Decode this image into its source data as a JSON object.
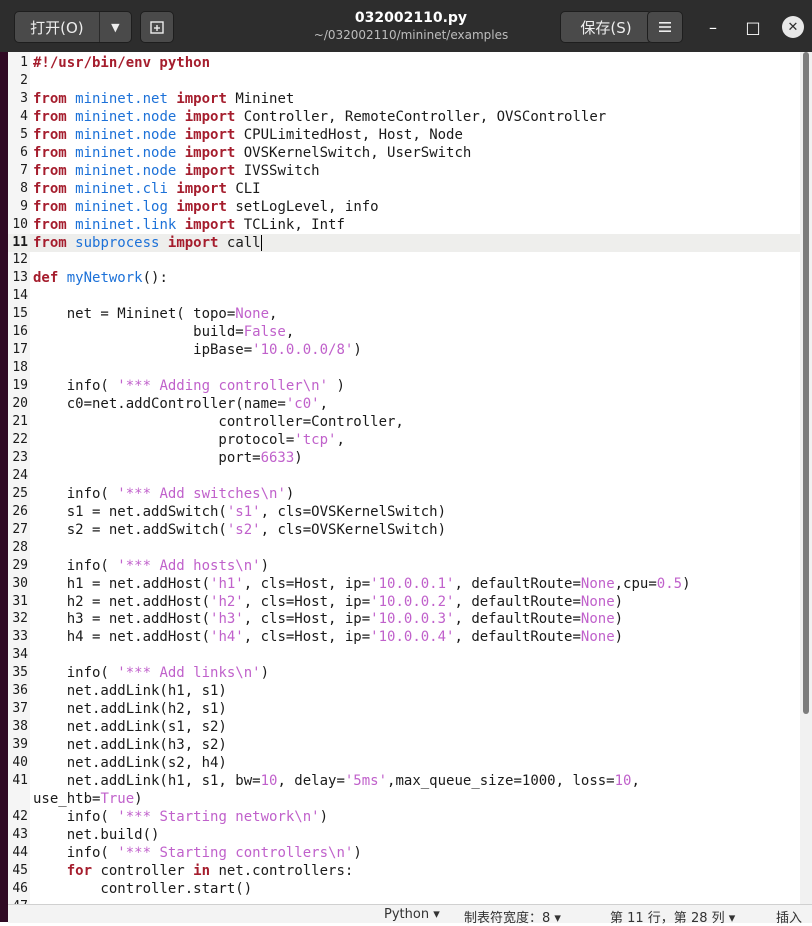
{
  "toolbar": {
    "open_label": "打开(O)",
    "open_menu_icon": "caret-down-icon",
    "new_tab_icon": "new-tab-icon",
    "save_label": "保存(S)",
    "menu_icon": "hamburger-icon"
  },
  "window": {
    "title": "032002110.py",
    "subtitle": "~/032002110/mininet/examples",
    "minimize": "–",
    "maximize": "□",
    "close": "✕"
  },
  "editor": {
    "current_line": 11,
    "lines": [
      {
        "n": "1",
        "tokens": [
          [
            "k",
            "#!/usr/bin/env python"
          ]
        ]
      },
      {
        "n": "2",
        "tokens": []
      },
      {
        "n": "3",
        "tokens": [
          [
            "k",
            "from"
          ],
          [
            "p",
            " "
          ],
          [
            "m",
            "mininet.net"
          ],
          [
            "p",
            " "
          ],
          [
            "k",
            "import"
          ],
          [
            "p",
            " Mininet"
          ]
        ]
      },
      {
        "n": "4",
        "tokens": [
          [
            "k",
            "from"
          ],
          [
            "p",
            " "
          ],
          [
            "m",
            "mininet.node"
          ],
          [
            "p",
            " "
          ],
          [
            "k",
            "import"
          ],
          [
            "p",
            " Controller, RemoteController, OVSController"
          ]
        ]
      },
      {
        "n": "5",
        "tokens": [
          [
            "k",
            "from"
          ],
          [
            "p",
            " "
          ],
          [
            "m",
            "mininet.node"
          ],
          [
            "p",
            " "
          ],
          [
            "k",
            "import"
          ],
          [
            "p",
            " CPULimitedHost, Host, Node"
          ]
        ]
      },
      {
        "n": "6",
        "tokens": [
          [
            "k",
            "from"
          ],
          [
            "p",
            " "
          ],
          [
            "m",
            "mininet.node"
          ],
          [
            "p",
            " "
          ],
          [
            "k",
            "import"
          ],
          [
            "p",
            " OVSKernelSwitch, UserSwitch"
          ]
        ]
      },
      {
        "n": "7",
        "tokens": [
          [
            "k",
            "from"
          ],
          [
            "p",
            " "
          ],
          [
            "m",
            "mininet.node"
          ],
          [
            "p",
            " "
          ],
          [
            "k",
            "import"
          ],
          [
            "p",
            " IVSSwitch"
          ]
        ]
      },
      {
        "n": "8",
        "tokens": [
          [
            "k",
            "from"
          ],
          [
            "p",
            " "
          ],
          [
            "m",
            "mininet.cli"
          ],
          [
            "p",
            " "
          ],
          [
            "k",
            "import"
          ],
          [
            "p",
            " CLI"
          ]
        ]
      },
      {
        "n": "9",
        "tokens": [
          [
            "k",
            "from"
          ],
          [
            "p",
            " "
          ],
          [
            "m",
            "mininet.log"
          ],
          [
            "p",
            " "
          ],
          [
            "k",
            "import"
          ],
          [
            "p",
            " setLogLevel, info"
          ]
        ]
      },
      {
        "n": "10",
        "tokens": [
          [
            "k",
            "from"
          ],
          [
            "p",
            " "
          ],
          [
            "m",
            "mininet.link"
          ],
          [
            "p",
            " "
          ],
          [
            "k",
            "import"
          ],
          [
            "p",
            " TCLink, Intf"
          ]
        ]
      },
      {
        "n": "11",
        "tokens": [
          [
            "k",
            "from"
          ],
          [
            "p",
            " "
          ],
          [
            "m",
            "subprocess"
          ],
          [
            "p",
            " "
          ],
          [
            "k",
            "import"
          ],
          [
            "p",
            " call"
          ]
        ]
      },
      {
        "n": "12",
        "tokens": []
      },
      {
        "n": "13",
        "tokens": [
          [
            "k",
            "def"
          ],
          [
            "p",
            " "
          ],
          [
            "m",
            "myNetwork"
          ],
          [
            "p",
            "():"
          ]
        ]
      },
      {
        "n": "14",
        "tokens": []
      },
      {
        "n": "15",
        "tokens": [
          [
            "p",
            "    net = Mininet( topo="
          ],
          [
            "s",
            "None"
          ],
          [
            "p",
            ","
          ]
        ]
      },
      {
        "n": "16",
        "tokens": [
          [
            "p",
            "                   build="
          ],
          [
            "s",
            "False"
          ],
          [
            "p",
            ","
          ]
        ]
      },
      {
        "n": "17",
        "tokens": [
          [
            "p",
            "                   ipBase="
          ],
          [
            "s",
            "'10.0.0.0/8'"
          ],
          [
            "p",
            ")"
          ]
        ]
      },
      {
        "n": "18",
        "tokens": []
      },
      {
        "n": "19",
        "tokens": [
          [
            "p",
            "    info( "
          ],
          [
            "s",
            "'*** Adding controller\\n'"
          ],
          [
            "p",
            " )"
          ]
        ]
      },
      {
        "n": "20",
        "tokens": [
          [
            "p",
            "    c0=net.addController(name="
          ],
          [
            "s",
            "'c0'"
          ],
          [
            "p",
            ","
          ]
        ]
      },
      {
        "n": "21",
        "tokens": [
          [
            "p",
            "                      controller=Controller,"
          ]
        ]
      },
      {
        "n": "22",
        "tokens": [
          [
            "p",
            "                      protocol="
          ],
          [
            "s",
            "'tcp'"
          ],
          [
            "p",
            ","
          ]
        ]
      },
      {
        "n": "23",
        "tokens": [
          [
            "p",
            "                      port="
          ],
          [
            "s",
            "6633"
          ],
          [
            "p",
            ")"
          ]
        ]
      },
      {
        "n": "24",
        "tokens": []
      },
      {
        "n": "25",
        "tokens": [
          [
            "p",
            "    info( "
          ],
          [
            "s",
            "'*** Add switches\\n'"
          ],
          [
            "p",
            ")"
          ]
        ]
      },
      {
        "n": "26",
        "tokens": [
          [
            "p",
            "    s1 = net.addSwitch("
          ],
          [
            "s",
            "'s1'"
          ],
          [
            "p",
            ", cls=OVSKernelSwitch)"
          ]
        ]
      },
      {
        "n": "27",
        "tokens": [
          [
            "p",
            "    s2 = net.addSwitch("
          ],
          [
            "s",
            "'s2'"
          ],
          [
            "p",
            ", cls=OVSKernelSwitch)"
          ]
        ]
      },
      {
        "n": "28",
        "tokens": []
      },
      {
        "n": "29",
        "tokens": [
          [
            "p",
            "    info( "
          ],
          [
            "s",
            "'*** Add hosts\\n'"
          ],
          [
            "p",
            ")"
          ]
        ]
      },
      {
        "n": "30",
        "tokens": [
          [
            "p",
            "    h1 = net.addHost("
          ],
          [
            "s",
            "'h1'"
          ],
          [
            "p",
            ", cls=Host, ip="
          ],
          [
            "s",
            "'10.0.0.1'"
          ],
          [
            "p",
            ", defaultRoute="
          ],
          [
            "s",
            "None"
          ],
          [
            "p",
            ",cpu="
          ],
          [
            "s",
            "0.5"
          ],
          [
            "p",
            ")"
          ]
        ]
      },
      {
        "n": "31",
        "tokens": [
          [
            "p",
            "    h2 = net.addHost("
          ],
          [
            "s",
            "'h2'"
          ],
          [
            "p",
            ", cls=Host, ip="
          ],
          [
            "s",
            "'10.0.0.2'"
          ],
          [
            "p",
            ", defaultRoute="
          ],
          [
            "s",
            "None"
          ],
          [
            "p",
            ")"
          ]
        ]
      },
      {
        "n": "32",
        "tokens": [
          [
            "p",
            "    h3 = net.addHost("
          ],
          [
            "s",
            "'h3'"
          ],
          [
            "p",
            ", cls=Host, ip="
          ],
          [
            "s",
            "'10.0.0.3'"
          ],
          [
            "p",
            ", defaultRoute="
          ],
          [
            "s",
            "None"
          ],
          [
            "p",
            ")"
          ]
        ]
      },
      {
        "n": "33",
        "tokens": [
          [
            "p",
            "    h4 = net.addHost("
          ],
          [
            "s",
            "'h4'"
          ],
          [
            "p",
            ", cls=Host, ip="
          ],
          [
            "s",
            "'10.0.0.4'"
          ],
          [
            "p",
            ", defaultRoute="
          ],
          [
            "s",
            "None"
          ],
          [
            "p",
            ")"
          ]
        ]
      },
      {
        "n": "34",
        "tokens": []
      },
      {
        "n": "35",
        "tokens": [
          [
            "p",
            "    info( "
          ],
          [
            "s",
            "'*** Add links\\n'"
          ],
          [
            "p",
            ")"
          ]
        ]
      },
      {
        "n": "36",
        "tokens": [
          [
            "p",
            "    net.addLink(h1, s1)"
          ]
        ]
      },
      {
        "n": "37",
        "tokens": [
          [
            "p",
            "    net.addLink(h2, s1)"
          ]
        ]
      },
      {
        "n": "38",
        "tokens": [
          [
            "p",
            "    net.addLink(s1, s2)"
          ]
        ]
      },
      {
        "n": "39",
        "tokens": [
          [
            "p",
            "    net.addLink(h3, s2)"
          ]
        ]
      },
      {
        "n": "40",
        "tokens": [
          [
            "p",
            "    net.addLink(s2, h4)"
          ]
        ]
      },
      {
        "n": "41",
        "tokens": [
          [
            "p",
            "    net.addLink(h1, s1, bw="
          ],
          [
            "s",
            "10"
          ],
          [
            "p",
            ", delay="
          ],
          [
            "s",
            "'5ms'"
          ],
          [
            "p",
            ",max_queue_size=1000, loss="
          ],
          [
            "s",
            "10"
          ],
          [
            "p",
            ","
          ]
        ]
      },
      {
        "n": "",
        "tokens": [
          [
            "p",
            "use_htb="
          ],
          [
            "s",
            "True"
          ],
          [
            "p",
            ")"
          ]
        ],
        "wrap": true
      },
      {
        "n": "42",
        "tokens": [
          [
            "p",
            "    info( "
          ],
          [
            "s",
            "'*** Starting network\\n'"
          ],
          [
            "p",
            ")"
          ]
        ]
      },
      {
        "n": "43",
        "tokens": [
          [
            "p",
            "    net.build()"
          ]
        ]
      },
      {
        "n": "44",
        "tokens": [
          [
            "p",
            "    info( "
          ],
          [
            "s",
            "'*** Starting controllers\\n'"
          ],
          [
            "p",
            ")"
          ]
        ]
      },
      {
        "n": "45",
        "tokens": [
          [
            "p",
            "    "
          ],
          [
            "k",
            "for"
          ],
          [
            "p",
            " controller "
          ],
          [
            "k",
            "in"
          ],
          [
            "p",
            " net.controllers:"
          ]
        ]
      },
      {
        "n": "46",
        "tokens": [
          [
            "p",
            "        controller.start()"
          ]
        ]
      },
      {
        "n": "47",
        "tokens": []
      }
    ]
  },
  "statusbar": {
    "language": "Python",
    "tab_width": "制表符宽度：8",
    "position": "第 11 行，第 28 列",
    "insert_mode": "插入"
  },
  "colors": {
    "keyword": "#a51d2d",
    "module": "#1c71d8",
    "literal": "#c061cb",
    "titlebar": "#2d2d2d"
  }
}
